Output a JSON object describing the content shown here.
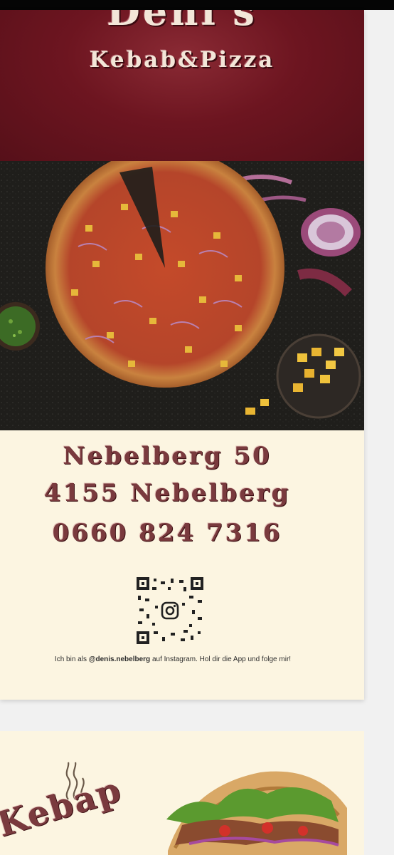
{
  "header": {
    "brand_name": "Deni's",
    "brand_sub": "Kebab&Pizza"
  },
  "address": {
    "street": "Nebelberg 50",
    "city": "4155 Nebelberg",
    "phone": "0660 824 7316"
  },
  "instagram": {
    "caption_prefix": "Ich bin als ",
    "handle": "@denis.nebelberg",
    "caption_suffix": " auf Instagram. Hol dir die App und folge mir!"
  },
  "section2": {
    "title": "Kebap"
  },
  "colors": {
    "header_bg": "#6d1520",
    "page_bg": "#fcf5e1",
    "text_accent": "#7a3a3e"
  },
  "icons": [
    "instagram-icon",
    "qr-code",
    "steam-icon"
  ]
}
